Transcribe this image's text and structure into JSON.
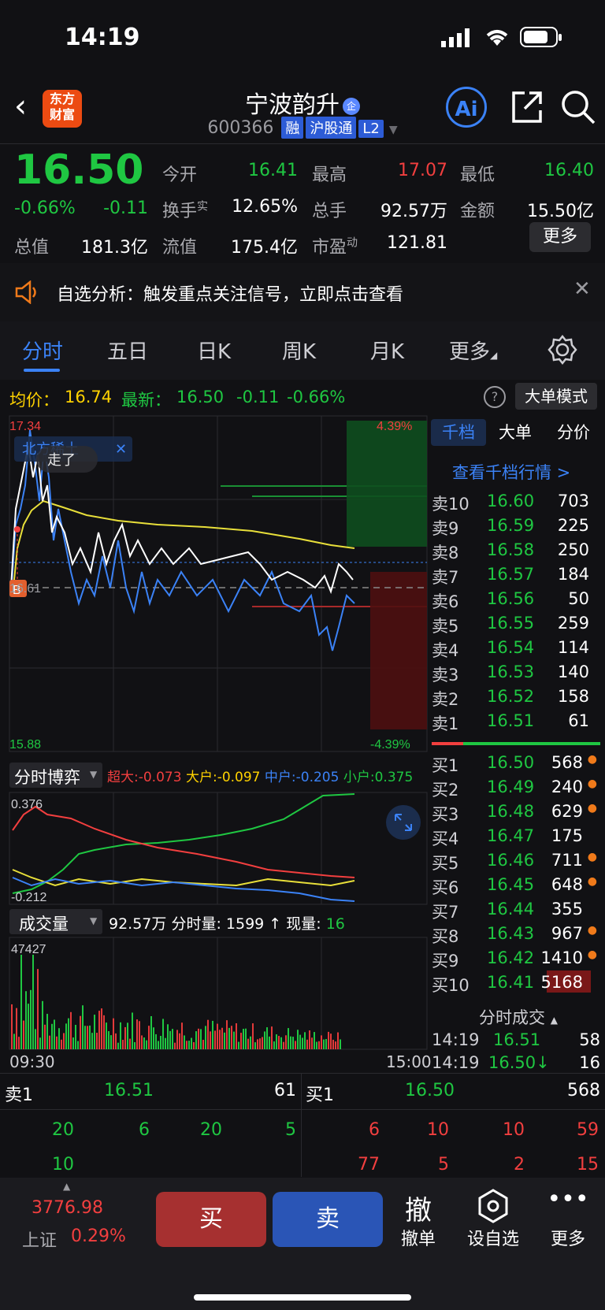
{
  "status": {
    "time": "14:19"
  },
  "header": {
    "logo_line1": "东方",
    "logo_line2": "财富",
    "stock_name": "宁波韵升",
    "badge": "企",
    "code": "600366",
    "tags": [
      "融",
      "沪股通",
      "L2"
    ],
    "ai": "Ai"
  },
  "quote": {
    "price": "16.50",
    "change_pct": "-0.66%",
    "change": "-0.11",
    "open_label": "今开",
    "open": "16.41",
    "high_label": "最高",
    "high": "17.07",
    "low_label": "最低",
    "low": "16.40",
    "turnover_label": "换手",
    "turnover_sup": "实",
    "turnover": "12.65%",
    "volume_label": "总手",
    "volume": "92.57万",
    "amount_label": "金额",
    "amount": "15.50亿",
    "mktcap_label": "总值",
    "mktcap": "181.3亿",
    "float_label": "流值",
    "float": "175.4亿",
    "pe_label": "市盈",
    "pe_sup": "动",
    "pe": "121.81",
    "more": "更多"
  },
  "notice": {
    "text": "自选分析：触发重点关注信号，立即点击查看"
  },
  "tabs": [
    "分时",
    "五日",
    "日K",
    "周K",
    "月K",
    "更多"
  ],
  "avgrow": {
    "avg_label": "均价：",
    "avg": "16.74",
    "latest_label": "最新：",
    "latest": "16.50",
    "chg": "-0.11",
    "pct": "-0.66%",
    "mode": "大单模式"
  },
  "chart": {
    "ymax": "17.34",
    "ymin": "15.88",
    "pmax": "4.39%",
    "pmin": "-4.39%",
    "ref": "16.61",
    "popup": "北方稀土",
    "popup_sub": "走了",
    "marker": "B",
    "fund_label": "分时博弈",
    "fund_items": [
      {
        "name": "超大",
        "value": "-0.073",
        "color": "#f23f3f"
      },
      {
        "name": "大户",
        "value": "-0.097",
        "color": "#ffd200"
      },
      {
        "name": "中户",
        "value": "-0.205",
        "color": "#3b82f6"
      },
      {
        "name": "小户",
        "value": "0.375",
        "color": "#1fc742"
      }
    ],
    "fund_max": "0.376",
    "fund_min": "-0.212",
    "vol_label": "成交量",
    "vol_total": "92.57万",
    "vol_min_label": "分时量:",
    "vol_min": "1599",
    "vol_now_label": "现量:",
    "vol_now": "16",
    "vol_max": "47427",
    "t_start": "09:30",
    "t_end": "15:00"
  },
  "book": {
    "tabs": [
      "千档",
      "大单",
      "分价"
    ],
    "link": "查看千档行情 >",
    "asks": [
      {
        "label": "卖10",
        "price": "16.60",
        "qty": "703"
      },
      {
        "label": "卖9",
        "price": "16.59",
        "qty": "225"
      },
      {
        "label": "卖8",
        "price": "16.58",
        "qty": "250"
      },
      {
        "label": "卖7",
        "price": "16.57",
        "qty": "184"
      },
      {
        "label": "卖6",
        "price": "16.56",
        "qty": "50"
      },
      {
        "label": "卖5",
        "price": "16.55",
        "qty": "259"
      },
      {
        "label": "卖4",
        "price": "16.54",
        "qty": "114"
      },
      {
        "label": "卖3",
        "price": "16.53",
        "qty": "140"
      },
      {
        "label": "卖2",
        "price": "16.52",
        "qty": "158"
      },
      {
        "label": "卖1",
        "price": "16.51",
        "qty": "61"
      }
    ],
    "bids": [
      {
        "label": "买1",
        "price": "16.50",
        "qty": "568"
      },
      {
        "label": "买2",
        "price": "16.49",
        "qty": "240"
      },
      {
        "label": "买3",
        "price": "16.48",
        "qty": "629"
      },
      {
        "label": "买4",
        "price": "16.47",
        "qty": "175"
      },
      {
        "label": "买5",
        "price": "16.46",
        "qty": "711"
      },
      {
        "label": "买6",
        "price": "16.45",
        "qty": "648"
      },
      {
        "label": "买7",
        "price": "16.44",
        "qty": "355"
      },
      {
        "label": "买8",
        "price": "16.43",
        "qty": "967"
      },
      {
        "label": "买9",
        "price": "16.42",
        "qty": "1410"
      },
      {
        "label": "买10",
        "price": "16.41",
        "qty": "5168"
      }
    ],
    "trades_title": "分时成交",
    "trades": [
      {
        "time": "14:19",
        "price": "16.51",
        "qty": "58"
      },
      {
        "time": "14:19",
        "price": "16.50↓",
        "qty": "16"
      }
    ]
  },
  "queue": {
    "sell_label": "卖1",
    "sell_price": "16.51",
    "sell_qty": "61",
    "buy_label": "买1",
    "buy_price": "16.50",
    "buy_qty": "568",
    "sell_row1": [
      "20",
      "6",
      "20",
      "5"
    ],
    "sell_row2": [
      "10"
    ],
    "buy_row1": [
      "6",
      "10",
      "10",
      "59"
    ],
    "buy_row2": [
      "77",
      "5",
      "2",
      "15"
    ]
  },
  "bottom": {
    "index_value": "3776.98",
    "index_name": "上证",
    "index_pct": "0.29%",
    "buy": "买",
    "sell": "卖",
    "cancel_icon": "撤",
    "cancel": "撤单",
    "watch": "设自选",
    "more": "更多"
  }
}
